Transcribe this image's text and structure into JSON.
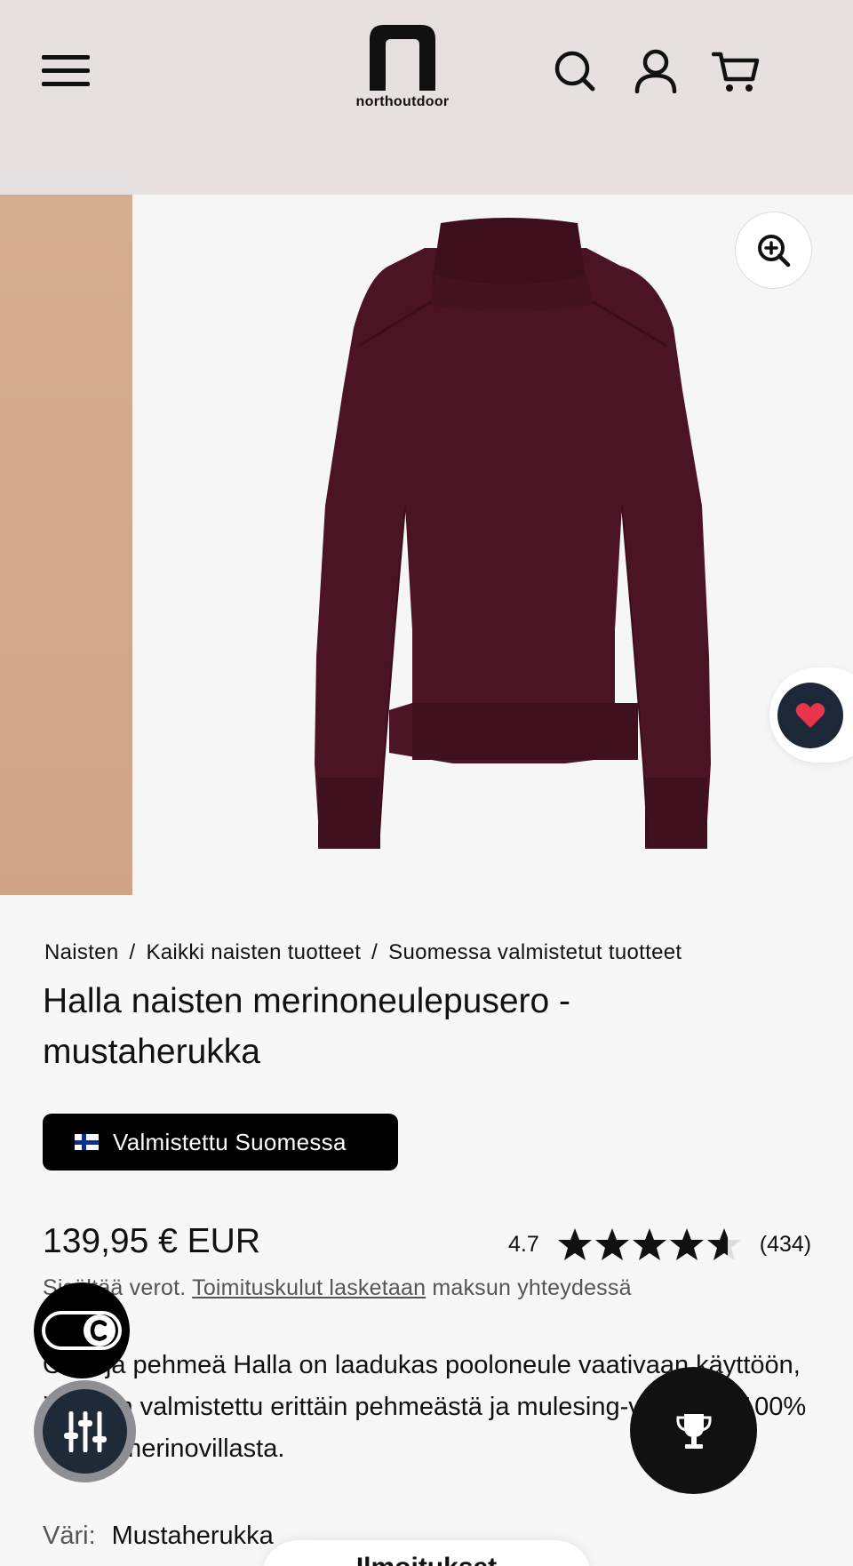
{
  "header": {
    "logo_text": "northoutdoor",
    "icons": [
      "menu-icon",
      "search-icon",
      "account-icon",
      "cart-icon"
    ]
  },
  "gallery": {
    "zoom_icon": "zoom-in-icon",
    "wishlist_icon": "heart-icon"
  },
  "breadcrumb": [
    {
      "label": "Naisten"
    },
    {
      "label": "Kaikki naisten tuotteet"
    },
    {
      "label": "Suomessa valmistetut tuotteet"
    }
  ],
  "breadcrumb_separator": "/",
  "product": {
    "title": "Halla naisten merinoneulepusero - mustaherukka",
    "badge": "Valmistettu Suomessa",
    "price": "139,95 € EUR",
    "rating": {
      "value": "4.7",
      "stars": 4.7,
      "max_stars": 5,
      "count": "(434)"
    },
    "tax_before": "Sisältää verot.",
    "tax_link": "Toimituskulut lasketaan",
    "tax_after": "maksun yhteydessä",
    "description": "Ohut ja pehmeä Halla on laadukas pooloneule vaativaan käyttöön, ja se on valmistettu erittäin pehmeästä ja mulesing-vapaasta 100% kampamerinovillasta.",
    "color_label": "Väri:",
    "color_value": "Mustaherukka",
    "bottom_pill_label": "Ilmoitukset"
  },
  "colors": {
    "header_bg": "#e6e1e0",
    "page_bg": "#f7f7f7",
    "sweater": "#4a1424",
    "badge_bg": "#000000",
    "wishlist_bg": "#1c2838",
    "heart": "#e8344d"
  }
}
